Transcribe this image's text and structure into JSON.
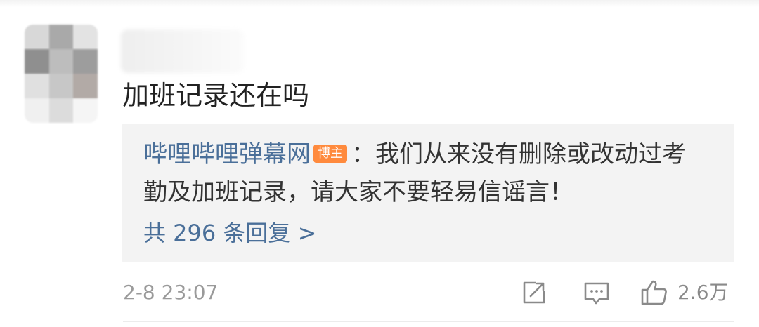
{
  "comment": {
    "text": "加班记录还在吗",
    "timestamp": "2-8 23:07"
  },
  "reply": {
    "author": "哔哩哔哩弹幕网",
    "badge": "博主",
    "line1": "：我们从来没有删除或改动过考",
    "line2": "勤及加班记录，请大家不要轻易信谣言！",
    "count_label": "共 296 条回复 >"
  },
  "actions": {
    "like_count": "2.6万",
    "icons": [
      "share-icon",
      "comment-icon",
      "like-icon"
    ]
  },
  "colors": {
    "link": "#4a6f99",
    "badge": "#ff8a3d",
    "reply_bg": "#f3f3f3",
    "muted": "#9a9a9a"
  }
}
